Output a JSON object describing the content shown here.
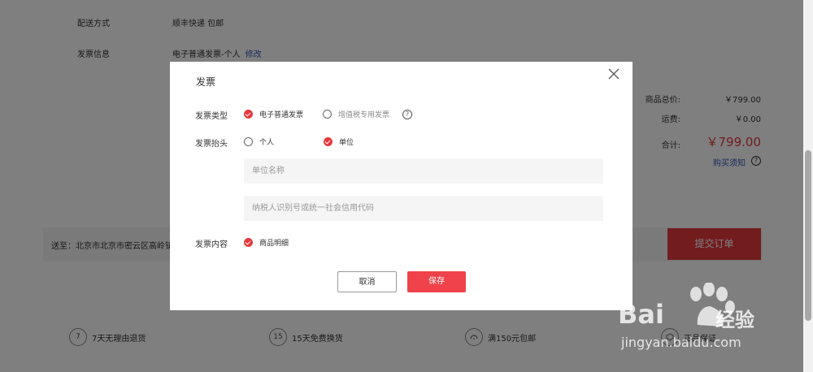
{
  "order": {
    "delivery_label": "配送方式",
    "delivery_value": "顺丰快递 包邮",
    "invoice_label": "发票信息",
    "invoice_value": "电子普通发票-个人",
    "invoice_edit": "修改"
  },
  "summary": {
    "goods_total_label": "商品总价:",
    "goods_total_value": "￥799.00",
    "shipping_label": "运费:",
    "shipping_value": "￥0.00",
    "total_label": "合计:",
    "total_value": "￥799.00",
    "notice_link": "购买须知"
  },
  "bottom_bar": {
    "address": "送至：北京市北京市密云区高岭镇",
    "submit_label": "提交订单"
  },
  "services": [
    {
      "icon_text": "7",
      "label": "7天无理由退货"
    },
    {
      "icon_text": "15",
      "label": "15天免费换货"
    },
    {
      "icon_text": "",
      "label": "满150元包邮"
    },
    {
      "icon_text": "",
      "label": "正品保证"
    }
  ],
  "modal": {
    "title": "发票",
    "type_label": "发票类型",
    "type_options": [
      {
        "label": "电子普通发票",
        "selected": true
      },
      {
        "label": "增值税专用发票",
        "selected": false
      }
    ],
    "header_label": "发票抬头",
    "header_options": [
      {
        "label": "个人",
        "selected": false
      },
      {
        "label": "单位",
        "selected": true
      }
    ],
    "company_placeholder": "单位名称",
    "taxid_placeholder": "纳税人识别号或统一社会信用代码",
    "content_label": "发票内容",
    "content_option": "商品明细",
    "cancel_label": "取消",
    "save_label": "保存"
  },
  "watermark": {
    "brand": "Bai",
    "brand_suffix": "经验",
    "url": "jingyan.baidu.com"
  },
  "colors": {
    "accent": "#e4393c",
    "link": "#2b5bb5",
    "overlay": "rgba(0,0,0,0.5)"
  }
}
